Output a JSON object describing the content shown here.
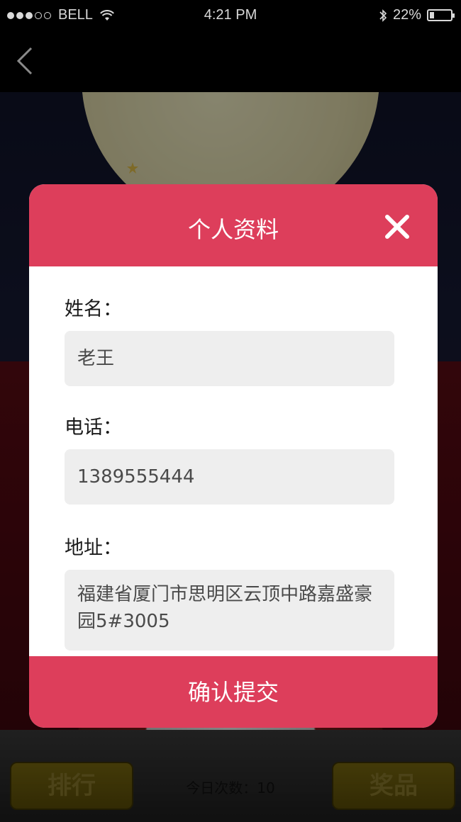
{
  "status_bar": {
    "carrier": "BELL",
    "time": "4:21 PM",
    "battery_percent": "22%",
    "battery_level": 0.22
  },
  "nav": {
    "back_icon": "chevron-left-icon"
  },
  "modal": {
    "title": "个人资料",
    "close_icon": "close-icon",
    "fields": [
      {
        "label": "姓名：",
        "value": "老王"
      },
      {
        "label": "电话：",
        "value": "1389555444"
      },
      {
        "label": "地址：",
        "value": "福建省厦门市思明区云顶中路嘉盛豪园5#3005"
      }
    ],
    "submit_label": "确认提交"
  },
  "bottom_bar": {
    "rank_label": "排行",
    "count_text": "今日次数：10",
    "prize_label": "奖品"
  },
  "colors": {
    "accent": "#dd3e5b",
    "input_bg": "#eeeeee"
  }
}
